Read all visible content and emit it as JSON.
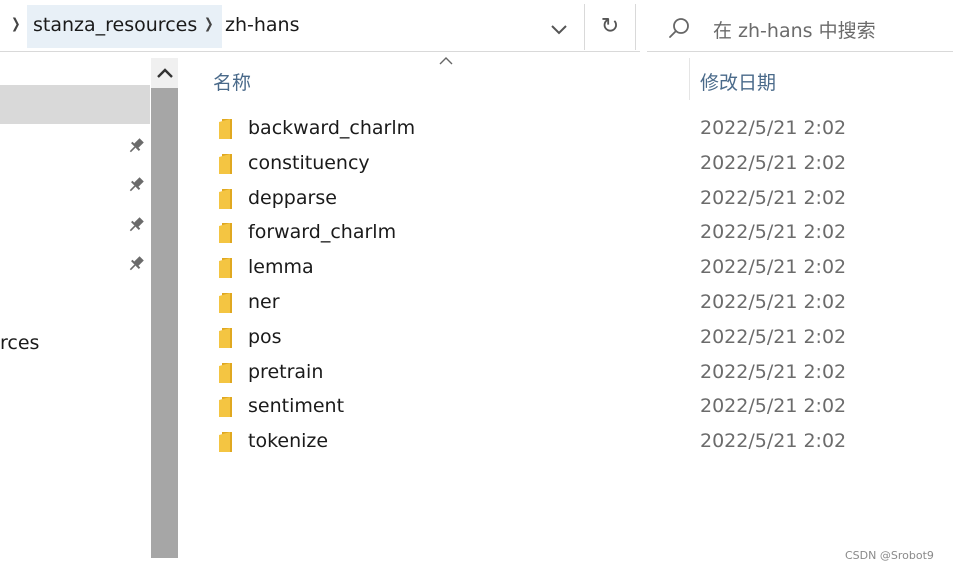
{
  "address": {
    "crumbs": [
      "stanza_resources",
      "zh-hans"
    ],
    "refresh_glyph": "↻"
  },
  "search": {
    "placeholder": "在 zh-hans 中搜索"
  },
  "nav": {
    "partial_label": "rces"
  },
  "columns": {
    "name": "名称",
    "date": "修改日期"
  },
  "files": [
    {
      "name": "backward_charlm",
      "date": "2022/5/21 2:02"
    },
    {
      "name": "constituency",
      "date": "2022/5/21 2:02"
    },
    {
      "name": "depparse",
      "date": "2022/5/21 2:02"
    },
    {
      "name": "forward_charlm",
      "date": "2022/5/21 2:02"
    },
    {
      "name": "lemma",
      "date": "2022/5/21 2:02"
    },
    {
      "name": "ner",
      "date": "2022/5/21 2:02"
    },
    {
      "name": "pos",
      "date": "2022/5/21 2:02"
    },
    {
      "name": "pretrain",
      "date": "2022/5/21 2:02"
    },
    {
      "name": "sentiment",
      "date": "2022/5/21 2:02"
    },
    {
      "name": "tokenize",
      "date": "2022/5/21 2:02"
    }
  ],
  "watermark": "CSDN @Srobot9",
  "icons": {
    "folder": "folder-icon",
    "pin": "pin-icon",
    "search": "search-icon",
    "dropdown": "chevron-down-icon",
    "refresh": "refresh-icon"
  },
  "colors": {
    "folder": "#f4c542",
    "header_text": "#4a6a8a",
    "selection": "#d9d9d9",
    "scrollbar": "#a6a6a6"
  }
}
